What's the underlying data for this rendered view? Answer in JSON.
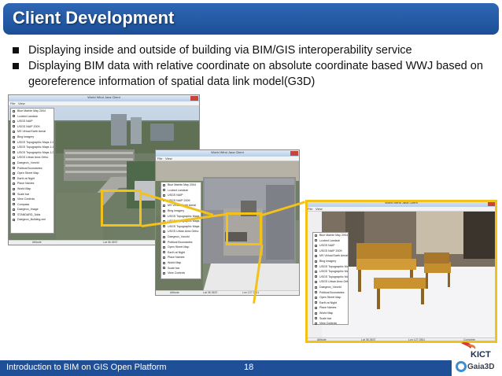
{
  "header": {
    "title": "Client Development"
  },
  "bullets": [
    {
      "text": "Displaying inside and outside of building via BIM/GIS interoperability service"
    },
    {
      "text": "Displaying BIM data with relative coordinate on absolute coordinate based WWJ based on georeference information of spatial data link model(G3D)"
    }
  ],
  "window_title": "World Wind Java Client",
  "menu": {
    "file": "File",
    "view": "View"
  },
  "layers": [
    "Blue Marble May 2004",
    "i-cubed Landsat",
    "USGS NAIP",
    "USGS NAIP 2009",
    "MS Virtual Earth Aerial",
    "Bing Imagery",
    "USGS Topographic Maps 1:250K",
    "USGS Topographic Maps 1:100K",
    "USGS Topographic Maps 1:24K",
    "USGS Urban Area Ortho",
    "Daegeon_Vworld",
    "Political Boundaries",
    "Open Street Map",
    "Earth at Night",
    "Place Names",
    "World Map",
    "Scale bar",
    "View Controls",
    "Compass",
    "Daegeon_Image",
    "STANDARD_3dds",
    "Daegeon_Building.xml"
  ],
  "status": {
    "altitude": "Altitude",
    "value": "2.1km",
    "lat": "Lat 36.3637",
    "lon": "Lon 127.3811",
    "elev": "Elev",
    "state": "Complete"
  },
  "footer": {
    "text": "Introduction to BIM on GIS Open Platform",
    "page": "18"
  },
  "logos": {
    "kict": "KICT",
    "gaia": "Gaia3D"
  },
  "colors": {
    "title_bg": "#1f4f96",
    "highlight": "#f2c21a",
    "footer_bg": "#1f4f96"
  }
}
